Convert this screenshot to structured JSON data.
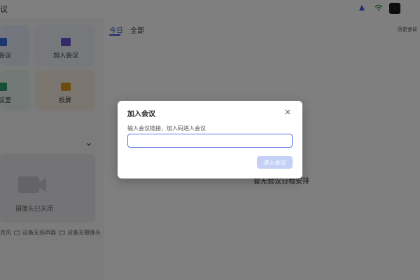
{
  "app": {
    "title": "议"
  },
  "topbar": {
    "icons": [
      "logo-icon",
      "wifi-icon",
      "help-icon",
      "avatar"
    ]
  },
  "left": {
    "tiles": [
      {
        "id": "join-partial",
        "label": "会议",
        "icon": "video-icon",
        "color": "#3a6fe0"
      },
      {
        "id": "join",
        "label": "加入会议",
        "icon": "plus-icon",
        "color": "#6b57d6"
      },
      {
        "id": "room-partial",
        "label": "议室",
        "icon": "room-icon",
        "color": "#2f9e6b"
      },
      {
        "id": "share",
        "label": "投屏",
        "icon": "screen-icon",
        "color": "#d89a1f"
      }
    ],
    "camera_label": "摄像头已关闭",
    "devices": {
      "mic": "克风",
      "speaker": "设备无扬声器",
      "camera": "设备无摄像头"
    }
  },
  "right": {
    "tabs": [
      "今日",
      "全部"
    ],
    "active_tab": 0,
    "records_button": "历史会议",
    "empty_text": "暂无会议日程安排"
  },
  "dialog": {
    "title": "加入会议",
    "label": "输入会议链接、加入码进入会议",
    "input_value": "",
    "input_placeholder": "",
    "submit": "进入会议"
  },
  "colors": {
    "accent": "#3a5bd9",
    "overlay": "rgba(0,0,0,0.5)"
  }
}
